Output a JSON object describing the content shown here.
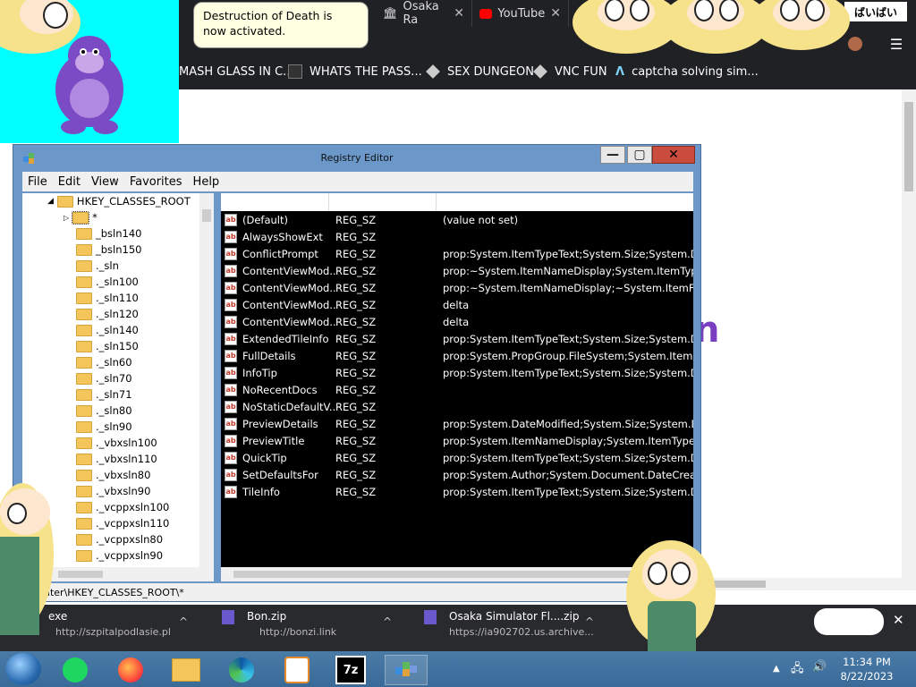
{
  "browser": {
    "tabs": [
      {
        "label": "Osaka Ra"
      },
      {
        "label": "YouTube"
      }
    ],
    "bookmarks": [
      {
        "label": "MASH GLASS IN C..."
      },
      {
        "label": "WHATS THE PASS..."
      },
      {
        "label": "SEX DUNGEON"
      },
      {
        "label": "VNC FUN"
      },
      {
        "label": "captcha solving sim..."
      }
    ],
    "corner_text": "ばいばい",
    "page_fragment": "n"
  },
  "balloon": {
    "text": "Destruction of Death is now activated."
  },
  "regedit": {
    "title": "Registry Editor",
    "menu": [
      "File",
      "Edit",
      "View",
      "Favorites",
      "Help"
    ],
    "tree_root": "HKEY_CLASSES_ROOT",
    "tree_items": [
      "*",
      "_bsln140",
      "_bsln150",
      "._sln",
      "._sln100",
      "._sln110",
      "._sln120",
      "._sln140",
      "._sln150",
      "._sln60",
      "._sln70",
      "._sln71",
      "._sln80",
      "._sln90",
      "._vbxsln100",
      "._vbxsln110",
      "._vbxsln80",
      "._vbxsln90",
      "._vcppxsln100",
      "._vcppxsln110",
      "._vcppxsln80",
      "._vcppxsln90"
    ],
    "values": [
      {
        "name": "(Default)",
        "type": "REG_SZ",
        "data": "(value not set)"
      },
      {
        "name": "AlwaysShowExt",
        "type": "REG_SZ",
        "data": ""
      },
      {
        "name": "ConflictPrompt",
        "type": "REG_SZ",
        "data": "prop:System.ItemTypeText;System.Size;System.Date..."
      },
      {
        "name": "ContentViewMod...",
        "type": "REG_SZ",
        "data": "prop:~System.ItemNameDisplay;System.ItemTypeTex..."
      },
      {
        "name": "ContentViewMod...",
        "type": "REG_SZ",
        "data": "prop:~System.ItemNameDisplay;~System.ItemFolde..."
      },
      {
        "name": "ContentViewMod...",
        "type": "REG_SZ",
        "data": "delta"
      },
      {
        "name": "ContentViewMod...",
        "type": "REG_SZ",
        "data": "delta"
      },
      {
        "name": "ExtendedTileInfo",
        "type": "REG_SZ",
        "data": "prop:System.ItemTypeText;System.Size;System.Date..."
      },
      {
        "name": "FullDetails",
        "type": "REG_SZ",
        "data": "prop:System.PropGroup.FileSystem;System.ItemNa..."
      },
      {
        "name": "InfoTip",
        "type": "REG_SZ",
        "data": "prop:System.ItemTypeText;System.Size;System.Date..."
      },
      {
        "name": "NoRecentDocs",
        "type": "REG_SZ",
        "data": ""
      },
      {
        "name": "NoStaticDefaultV...",
        "type": "REG_SZ",
        "data": ""
      },
      {
        "name": "PreviewDetails",
        "type": "REG_SZ",
        "data": "prop:System.DateModified;System.Size;System.Date..."
      },
      {
        "name": "PreviewTitle",
        "type": "REG_SZ",
        "data": "prop:System.ItemNameDisplay;System.ItemTypeText"
      },
      {
        "name": "QuickTip",
        "type": "REG_SZ",
        "data": "prop:System.ItemTypeText;System.Size;System.Date..."
      },
      {
        "name": "SetDefaultsFor",
        "type": "REG_SZ",
        "data": "prop:System.Author;System.Document.DateCreated"
      },
      {
        "name": "TileInfo",
        "type": "REG_SZ",
        "data": "prop:System.ItemTypeText;System.Size;System.Date..."
      }
    ],
    "status_path": "uter\\HKEY_CLASSES_ROOT\\*"
  },
  "downloads": [
    {
      "name": "exe",
      "url": "http://szpitalpodlasie.pl"
    },
    {
      "name": "Bon.zip",
      "url": "http://bonzi.link"
    },
    {
      "name": "Osaka Simulator Fl....zip",
      "url": "https://ia902702.us.archive..."
    }
  ],
  "taskbar": {
    "time": "11:34 PM",
    "date": "8/22/2023"
  },
  "colors": {
    "cyan": "#00ffff",
    "bonzi_purple": "#7a4bc4",
    "regedit_border": "#6b98c9",
    "close_red": "#c94c3d"
  }
}
